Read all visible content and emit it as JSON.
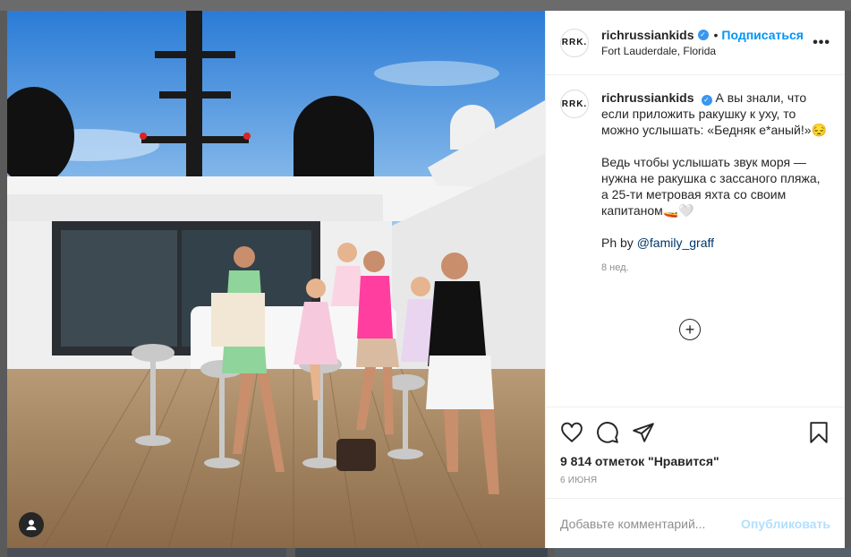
{
  "post": {
    "username": "richrussiankids",
    "logo_text": "RRK.",
    "follow_label": "Подписаться",
    "location": "Fort Lauderdale, Florida",
    "more_icon": "•••",
    "caption_line1": "А вы знали, что если приложить ракушку к уху, то можно услышать: «Бедняк е*аный!»😔",
    "caption_line2": "Ведь чтобы услышать звук моря — нужна не ракушка с зассаного пляжа, а 25-ти метровая яхта со своим капитаном🚤🤍",
    "caption_ph": "Ph by ",
    "caption_mention": "@family_graff",
    "time_ago": "8 нед.",
    "likes": "9 814 отметок \"Нравится\"",
    "date": "6 июня",
    "comment_placeholder": "Добавьте комментарий...",
    "publish_label": "Опубликовать"
  },
  "icons": {
    "verified": "verified-badge-icon",
    "like": "heart-icon",
    "comment": "comment-icon",
    "share": "paper-plane-icon",
    "save": "bookmark-icon",
    "load_more": "plus-circle-icon",
    "user_tag": "user-tag-icon"
  },
  "colors": {
    "accent": "#0095f6",
    "publish_disabled": "#b2dffc",
    "muted": "#8e8e8e",
    "text": "#262626"
  }
}
